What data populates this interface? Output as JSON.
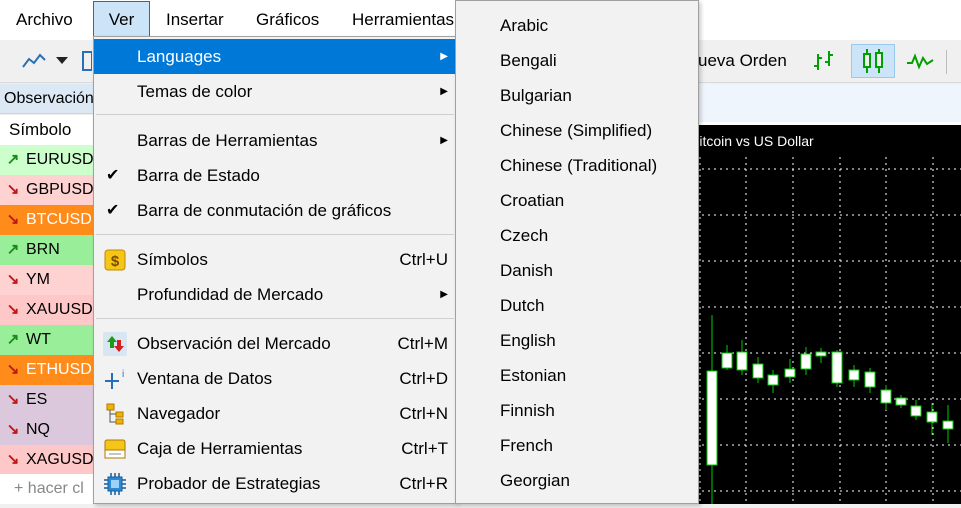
{
  "menubar": {
    "items": [
      "Archivo",
      "Ver",
      "Insertar",
      "Gráficos",
      "Herramientas"
    ]
  },
  "toolbar": {
    "new_order_label": "ueva Orden"
  },
  "market_watch": {
    "title": "Observación",
    "column_symbol": "Símbolo",
    "rows": [
      {
        "symbol": "EURUSD",
        "dir": "up",
        "color": "#ccffcc"
      },
      {
        "symbol": "GBPUSD",
        "dir": "down",
        "color": "#ffd2d2"
      },
      {
        "symbol": "BTCUSD",
        "dir": "down",
        "color": "#ff8c1a"
      },
      {
        "symbol": "BRN",
        "dir": "up",
        "color": "#99ee99"
      },
      {
        "symbol": "YM",
        "dir": "down",
        "color": "#ffd2d2"
      },
      {
        "symbol": "XAUUSD",
        "dir": "down",
        "color": "#ffc8c8"
      },
      {
        "symbol": "WT",
        "dir": "up",
        "color": "#99ee99"
      },
      {
        "symbol": "ETHUSD",
        "dir": "down",
        "color": "#ff8c1a"
      },
      {
        "symbol": "ES",
        "dir": "down",
        "color": "#dcc8dc"
      },
      {
        "symbol": "NQ",
        "dir": "down",
        "color": "#dcc8dc"
      },
      {
        "symbol": "XAGUSD",
        "dir": "down",
        "color": "#ffc8c8"
      }
    ],
    "footer": "+ hacer cl"
  },
  "chart": {
    "title": "Bitcoin vs US Dollar"
  },
  "ver_menu": {
    "items": [
      {
        "label": "Languages",
        "shortcut": "",
        "submenu": true
      },
      {
        "label": "Temas de color",
        "shortcut": "",
        "submenu": true
      },
      {
        "label": "Barras de Herramientas",
        "shortcut": "",
        "submenu": true
      },
      {
        "label": "Barra de Estado",
        "shortcut": "",
        "checked": true
      },
      {
        "label": "Barra de conmutación de gráficos",
        "shortcut": "",
        "checked": true
      },
      {
        "label": "Símbolos",
        "shortcut": "Ctrl+U",
        "icon": "symbols-icon"
      },
      {
        "label": "Profundidad de Mercado",
        "shortcut": "",
        "submenu": true
      },
      {
        "label": "Observación del Mercado",
        "shortcut": "Ctrl+M",
        "icon": "market-watch-icon"
      },
      {
        "label": "Ventana de Datos",
        "shortcut": "Ctrl+D",
        "icon": "data-window-icon"
      },
      {
        "label": "Navegador",
        "shortcut": "Ctrl+N",
        "icon": "navigator-icon"
      },
      {
        "label": "Caja de Herramientas",
        "shortcut": "Ctrl+T",
        "icon": "toolbox-icon"
      },
      {
        "label": "Probador de Estrategias",
        "shortcut": "Ctrl+R",
        "icon": "strategy-tester-icon"
      }
    ]
  },
  "languages": [
    "Arabic",
    "Bengali",
    "Bulgarian",
    "Chinese (Simplified)",
    "Chinese (Traditional)",
    "Croatian",
    "Czech",
    "Danish",
    "Dutch",
    "English",
    "Estonian",
    "Finnish",
    "French",
    "Georgian"
  ],
  "colors": {
    "highlight": "#0078d7",
    "candle_up": "#00cc00",
    "candle_body": "#ffffff"
  }
}
